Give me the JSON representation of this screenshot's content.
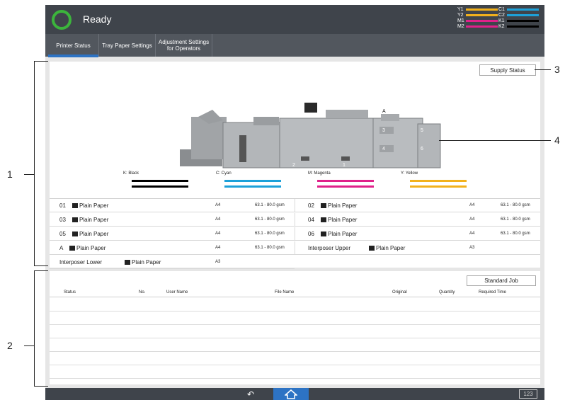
{
  "status": {
    "text": "Ready",
    "color": "#3cb53c"
  },
  "toner": {
    "left": [
      {
        "label": "Y1",
        "color": "#f2b11c"
      },
      {
        "label": "Y2",
        "color": "#f2b11c"
      },
      {
        "label": "M1",
        "color": "#e0218a"
      },
      {
        "label": "M2",
        "color": "#e0218a"
      }
    ],
    "right": [
      {
        "label": "C1",
        "color": "#1da1d9"
      },
      {
        "label": "C2",
        "color": "#1da1d9"
      },
      {
        "label": "K1",
        "color": "#000000"
      },
      {
        "label": "K2",
        "color": "#000000"
      }
    ]
  },
  "tabs": {
    "printer_status": "Printer Status",
    "tray_paper": "Tray Paper Settings",
    "adjustment_line1": "Adjustment Settings",
    "adjustment_line2": "for Operators"
  },
  "supply_status_label": "Supply Status",
  "machine_labels": [
    "A",
    "3",
    "4",
    "5",
    "6",
    "2",
    "1"
  ],
  "colors": [
    {
      "label": "K: Black",
      "color": "#000000"
    },
    {
      "label": "C: Cyan",
      "color": "#1da1d9"
    },
    {
      "label": "M: Magenta",
      "color": "#e0218a"
    },
    {
      "label": "Y: Yellow",
      "color": "#f2b11c"
    }
  ],
  "trays": [
    {
      "name": "01",
      "paper": "Plain Paper",
      "size": "A4",
      "weight": "63.1 - 80.0 gsm"
    },
    {
      "name": "02",
      "paper": "Plain Paper",
      "size": "A4",
      "weight": "63.1 - 80.0 gsm"
    },
    {
      "name": "03",
      "paper": "Plain Paper",
      "size": "A4",
      "weight": "63.1 - 80.0 gsm"
    },
    {
      "name": "04",
      "paper": "Plain Paper",
      "size": "A4",
      "weight": "63.1 - 80.0 gsm"
    },
    {
      "name": "05",
      "paper": "Plain Paper",
      "size": "A4",
      "weight": "63.1 - 80.0 gsm"
    },
    {
      "name": "06",
      "paper": "Plain Paper",
      "size": "A4",
      "weight": "63.1 - 80.0 gsm"
    },
    {
      "name": "A",
      "paper": "Plain Paper",
      "size": "A4",
      "weight": "63.1 - 80.0 gsm"
    },
    {
      "name": "Interposer Upper",
      "paper": "Plain Paper",
      "size": "A3",
      "weight": ""
    },
    {
      "name": "Interposer Lower",
      "paper": "Plain Paper",
      "size": "A3",
      "weight": ""
    }
  ],
  "job_button_label": "Standard Job",
  "job_columns": [
    "Status",
    "No.",
    "User Name",
    "File Name",
    "Original",
    "Quantity",
    "Required Time"
  ],
  "bottom": {
    "keyboard_label": "123"
  },
  "callouts": [
    "1",
    "2",
    "3",
    "4"
  ]
}
